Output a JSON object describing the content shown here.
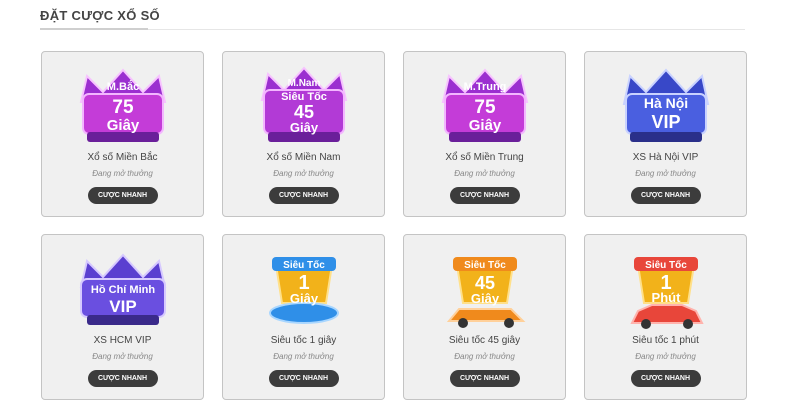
{
  "section": {
    "title": "ĐẶT CƯỢC XỔ SỐ"
  },
  "cards": [
    {
      "badge_lines": [
        "M.Bắc",
        "75",
        "Giây"
      ],
      "name": "Xổ số Miền Bắc",
      "status": "Đang mở thưởng",
      "button": "CƯỢC NHANH",
      "icon": "crown-emblem",
      "color": "#c43cd8"
    },
    {
      "badge_lines": [
        "M.Nam",
        "Siêu Tốc",
        "45",
        "Giây"
      ],
      "name": "Xổ số Miền Nam",
      "status": "Đang mở thưởng",
      "button": "CƯỢC NHANH",
      "icon": "crown-emblem",
      "color": "#b23ad6"
    },
    {
      "badge_lines": [
        "M.Trung",
        "75",
        "Giây"
      ],
      "name": "Xổ số Miền Trung",
      "status": "Đang mở thưởng",
      "button": "CƯỢC NHANH",
      "icon": "crown-emblem",
      "color": "#c43cd8"
    },
    {
      "badge_lines": [
        "Hà Nội",
        "VIP"
      ],
      "name": "XS Hà Nội VIP",
      "status": "Đang mở thưởng",
      "button": "CƯỢC NHANH",
      "icon": "crown-emblem",
      "color": "#4a5fe0"
    },
    {
      "badge_lines": [
        "Hồ Chí Minh",
        "VIP"
      ],
      "name": "XS HCM VIP",
      "status": "Đang mở thưởng",
      "button": "CƯỢC NHANH",
      "icon": "crown-emblem",
      "color": "#6a4fe0"
    },
    {
      "badge_lines": [
        "Siêu Tốc",
        "1",
        "Giây"
      ],
      "name": "Siêu tốc 1 giây",
      "status": "Đang mở thưởng",
      "button": "CƯỢC NHANH",
      "icon": "trophy-train-emblem",
      "color": "#2f8fe8"
    },
    {
      "badge_lines": [
        "Siêu Tốc",
        "45",
        "Giây"
      ],
      "name": "Siêu tốc 45 giây",
      "status": "Đang mở thưởng",
      "button": "CƯỢC NHANH",
      "icon": "trophy-racecar-emblem",
      "color": "#f08a1c"
    },
    {
      "badge_lines": [
        "Siêu Tốc",
        "1",
        "Phút"
      ],
      "name": "Siêu tốc 1 phút",
      "status": "Đang mở thưởng",
      "button": "CƯỢC NHANH",
      "icon": "trophy-car-emblem",
      "color": "#e8463a"
    }
  ]
}
